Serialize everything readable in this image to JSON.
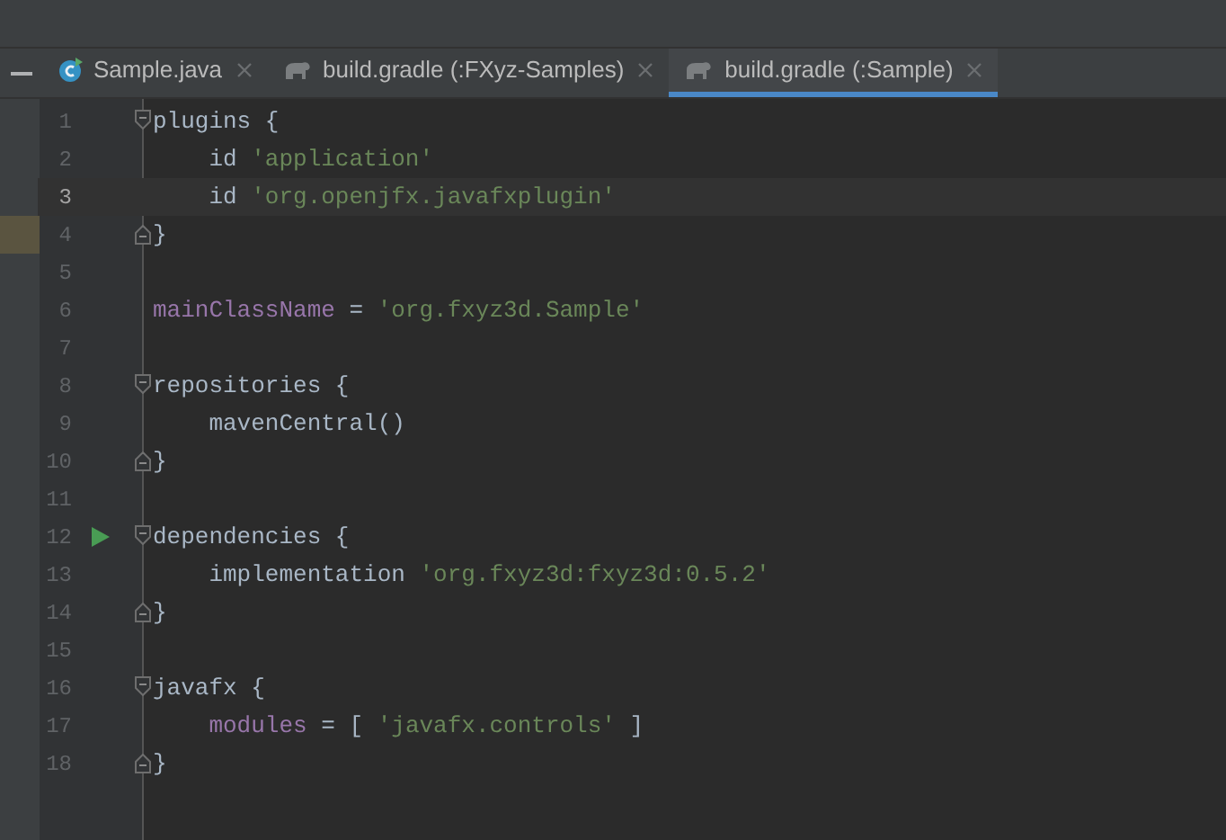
{
  "tabs": [
    {
      "label": "Sample.java",
      "kind": "java",
      "selected": false
    },
    {
      "label": "build.gradle (:FXyz-Samples)",
      "kind": "gradle",
      "selected": false
    },
    {
      "label": "build.gradle (:Sample)",
      "kind": "gradle",
      "selected": true
    }
  ],
  "lines": [
    {
      "number": "1",
      "fold_start": true,
      "fold_end": false,
      "run": false,
      "current": false,
      "marked": false,
      "tokens": [
        {
          "kind": "plain",
          "text": "plugins {"
        }
      ]
    },
    {
      "number": "2",
      "fold_start": false,
      "fold_end": false,
      "run": false,
      "current": false,
      "marked": false,
      "tokens": [
        {
          "kind": "plain",
          "text": "    id "
        },
        {
          "kind": "string",
          "text": "'application'"
        }
      ]
    },
    {
      "number": "3",
      "fold_start": false,
      "fold_end": false,
      "run": false,
      "current": true,
      "marked": false,
      "tokens": [
        {
          "kind": "plain",
          "text": "    id "
        },
        {
          "kind": "string",
          "text": "'org.openjfx.javafxplugin'"
        }
      ]
    },
    {
      "number": "4",
      "fold_start": false,
      "fold_end": true,
      "run": false,
      "current": false,
      "marked": true,
      "tokens": [
        {
          "kind": "plain",
          "text": "}"
        }
      ]
    },
    {
      "number": "5",
      "fold_start": false,
      "fold_end": false,
      "run": false,
      "current": false,
      "marked": false
    },
    {
      "number": "6",
      "fold_start": false,
      "fold_end": false,
      "run": false,
      "current": false,
      "marked": false,
      "tokens": [
        {
          "kind": "property",
          "text": "mainClassName"
        },
        {
          "kind": "plain",
          "text": " = "
        },
        {
          "kind": "string",
          "text": "'org.fxyz3d.Sample'"
        }
      ]
    },
    {
      "number": "7",
      "fold_start": false,
      "fold_end": false,
      "run": false,
      "current": false,
      "marked": false
    },
    {
      "number": "8",
      "fold_start": true,
      "fold_end": false,
      "run": false,
      "current": false,
      "marked": false,
      "tokens": [
        {
          "kind": "plain",
          "text": "repositories {"
        }
      ]
    },
    {
      "number": "9",
      "fold_start": false,
      "fold_end": false,
      "run": false,
      "current": false,
      "marked": false,
      "tokens": [
        {
          "kind": "plain",
          "text": "    mavenCentral()"
        }
      ]
    },
    {
      "number": "10",
      "fold_start": false,
      "fold_end": true,
      "run": false,
      "current": false,
      "marked": false,
      "tokens": [
        {
          "kind": "plain",
          "text": "}"
        }
      ]
    },
    {
      "number": "11",
      "fold_start": false,
      "fold_end": false,
      "run": false,
      "current": false,
      "marked": false
    },
    {
      "number": "12",
      "fold_start": true,
      "fold_end": false,
      "run": true,
      "current": false,
      "marked": false,
      "tokens": [
        {
          "kind": "plain",
          "text": "dependencies {"
        }
      ]
    },
    {
      "number": "13",
      "fold_start": false,
      "fold_end": false,
      "run": false,
      "current": false,
      "marked": false,
      "tokens": [
        {
          "kind": "plain",
          "text": "    implementation "
        },
        {
          "kind": "string",
          "text": "'org.fxyz3d:fxyz3d:0.5.2'"
        }
      ]
    },
    {
      "number": "14",
      "fold_start": false,
      "fold_end": true,
      "run": false,
      "current": false,
      "marked": false,
      "tokens": [
        {
          "kind": "plain",
          "text": "}"
        }
      ]
    },
    {
      "number": "15",
      "fold_start": false,
      "fold_end": false,
      "run": false,
      "current": false,
      "marked": false
    },
    {
      "number": "16",
      "fold_start": true,
      "fold_end": false,
      "run": false,
      "current": false,
      "marked": false,
      "tokens": [
        {
          "kind": "plain",
          "text": "javafx {"
        }
      ]
    },
    {
      "number": "17",
      "fold_start": false,
      "fold_end": false,
      "run": false,
      "current": false,
      "marked": false,
      "tokens": [
        {
          "kind": "property",
          "text": "    modules"
        },
        {
          "kind": "plain",
          "text": " = [ "
        },
        {
          "kind": "string",
          "text": "'javafx.controls'"
        },
        {
          "kind": "plain",
          "text": " ]"
        }
      ]
    },
    {
      "number": "18",
      "fold_start": false,
      "fold_end": true,
      "run": false,
      "current": false,
      "marked": false,
      "tokens": [
        {
          "kind": "plain",
          "text": "}"
        }
      ]
    }
  ]
}
